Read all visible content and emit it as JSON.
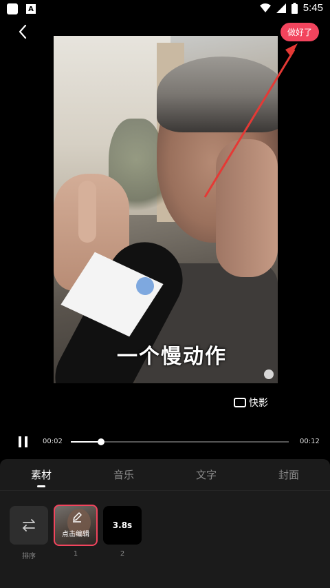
{
  "status_bar": {
    "time": "5:45",
    "left_icons": [
      "square-app-icon",
      "a-icon"
    ],
    "right_icons": [
      "wifi-icon",
      "signal-icon",
      "battery-icon"
    ]
  },
  "header": {
    "done_label": "做好了"
  },
  "video": {
    "subtitle": "一个慢动作"
  },
  "kuaiying": {
    "label": "快影"
  },
  "player": {
    "current_time": "00:02",
    "total_time": "00:12",
    "progress": 0.14
  },
  "tabs": [
    {
      "label": "素材",
      "active": true
    },
    {
      "label": "音乐",
      "active": false
    },
    {
      "label": "文字",
      "active": false
    },
    {
      "label": "封面",
      "active": false
    }
  ],
  "clips": {
    "sort_label": "排序",
    "clip1": {
      "edit_text": "点击编辑",
      "number": "1"
    },
    "clip2": {
      "duration": "3.8s",
      "number": "2"
    }
  },
  "colors": {
    "accent": "#f2445d",
    "panel_bg": "#1b1b1b"
  }
}
